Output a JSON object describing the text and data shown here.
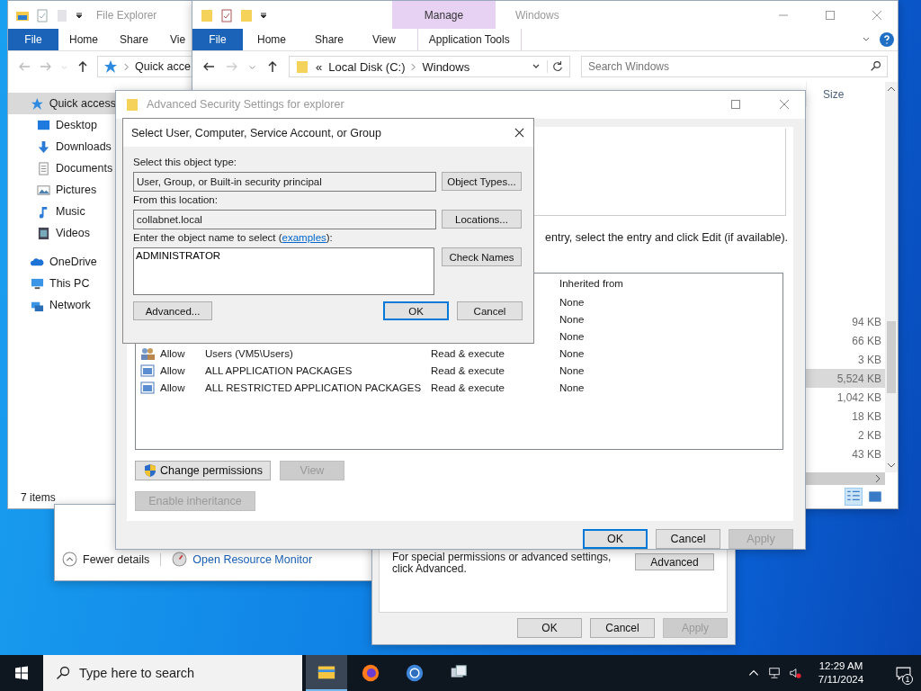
{
  "explorer_back": {
    "title": "File Explorer",
    "ribbon_tabs": [
      {
        "label": "File",
        "kind": "file"
      },
      {
        "label": "Home",
        "kind": "tab"
      },
      {
        "label": "Share",
        "kind": "tab"
      },
      {
        "label": "Vie",
        "kind": "tab"
      }
    ],
    "address": "Quick acce",
    "nav": [
      {
        "label": "Quick access",
        "selected": true,
        "children": [
          {
            "label": "Desktop",
            "selected": false
          },
          {
            "label": "Downloads",
            "selected": false
          },
          {
            "label": "Documents",
            "selected": false
          },
          {
            "label": "Pictures",
            "selected": false
          },
          {
            "label": "Music",
            "selected": false
          },
          {
            "label": "Videos",
            "selected": false
          }
        ]
      },
      {
        "label": "OneDrive",
        "selected": false
      },
      {
        "label": "This PC",
        "selected": false
      },
      {
        "label": "Network",
        "selected": false
      }
    ],
    "status": "7 items"
  },
  "explorer_front": {
    "title": "Windows",
    "context_group": "Manage",
    "ribbon_tabs": [
      {
        "label": "File",
        "kind": "file"
      },
      {
        "label": "Home",
        "kind": "tab"
      },
      {
        "label": "Share",
        "kind": "tab"
      },
      {
        "label": "View",
        "kind": "tab"
      },
      {
        "label": "Application Tools",
        "kind": "context"
      }
    ],
    "breadcrumb": [
      "«",
      "Local Disk (C:)",
      "Windows"
    ],
    "search": {
      "placeholder": "Search Windows"
    },
    "size_header": "Size",
    "sizes": [
      {
        "value": "94 KB",
        "selected": false
      },
      {
        "value": "66 KB",
        "selected": false
      },
      {
        "value": "3 KB",
        "selected": false
      },
      {
        "value": "5,524 KB",
        "selected": true
      },
      {
        "value": "1,042 KB",
        "selected": false
      },
      {
        "value": "18 KB",
        "selected": false
      },
      {
        "value": "2 KB",
        "selected": false
      },
      {
        "value": "43 KB",
        "selected": false
      }
    ]
  },
  "task_manager": {
    "details_toggle": "Fewer details",
    "link": "Open Resource Monitor"
  },
  "properties": {
    "note": "For special permissions or advanced settings, click Advanced.",
    "advanced_button": "Advanced",
    "buttons": [
      {
        "label": "OK",
        "disabled": false
      },
      {
        "label": "Cancel",
        "disabled": false
      },
      {
        "label": "Apply",
        "disabled": true
      }
    ]
  },
  "advanced_security": {
    "title": "Advanced Security Settings for explorer",
    "instruction": "entry, select the entry and click Edit (if available).",
    "column_header": "Inherited from",
    "entries": [
      {
        "kind": "hidden",
        "inherited": "None"
      },
      {
        "kind": "hidden",
        "inherited": "None"
      },
      {
        "kind": "hidden",
        "inherited": "None"
      },
      {
        "kind": "group",
        "type": "Allow",
        "principal": "Users (VM5\\Users)",
        "access": "Read & execute",
        "inherited": "None"
      },
      {
        "kind": "package",
        "type": "Allow",
        "principal": "ALL APPLICATION PACKAGES",
        "access": "Read & execute",
        "inherited": "None"
      },
      {
        "kind": "package",
        "type": "Allow",
        "principal": "ALL RESTRICTED APPLICATION PACKAGES",
        "access": "Read & execute",
        "inherited": "None"
      }
    ],
    "actions": [
      {
        "label": "Change permissions",
        "disabled": false,
        "shield": true
      },
      {
        "label": "View",
        "disabled": true,
        "shield": false
      }
    ],
    "inheritance_button": {
      "label": "Enable inheritance",
      "disabled": true
    },
    "buttons": [
      {
        "label": "OK",
        "default": true,
        "disabled": false
      },
      {
        "label": "Cancel",
        "default": false,
        "disabled": false
      },
      {
        "label": "Apply",
        "default": false,
        "disabled": true
      }
    ]
  },
  "select_dialog": {
    "title": "Select User, Computer, Service Account, or Group",
    "object_type_label": "Select this object type:",
    "object_type": "User, Group, or Built-in security principal",
    "object_types_button": "Object Types...",
    "location_label": "From this location:",
    "location": "collabnet.local",
    "locations_button": "Locations...",
    "name_label": "Enter the object name to select (",
    "examples_link": "examples",
    "name_label_end": "):",
    "name_value": "ADMINISTRATOR",
    "check_names_button": "Check Names",
    "advanced_button": "Advanced...",
    "buttons": [
      {
        "label": "OK",
        "default": true
      },
      {
        "label": "Cancel",
        "default": false
      }
    ]
  },
  "taskbar": {
    "search": {
      "placeholder": "Type here to search"
    },
    "apps": [
      {
        "active": true
      },
      {
        "active": false
      },
      {
        "active": false
      },
      {
        "active": false
      }
    ],
    "time": "12:29 AM",
    "date": "7/11/2024",
    "notifications": "1"
  }
}
